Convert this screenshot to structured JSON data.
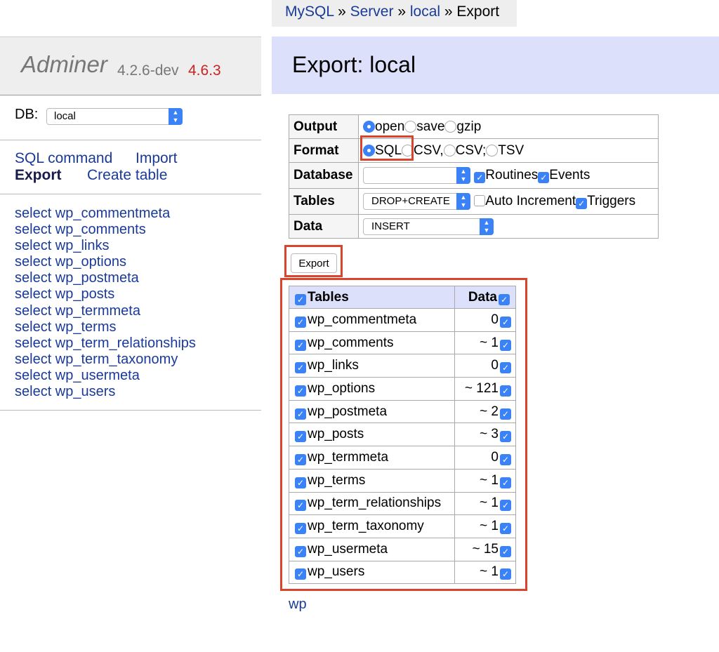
{
  "breadcrumb": {
    "mysql": "MySQL",
    "server": "Server",
    "local": "local",
    "current": "Export",
    "sep": "»"
  },
  "logo": {
    "name": "Adminer",
    "version": "4.2.6-dev",
    "new_version": "4.6.3"
  },
  "db": {
    "label": "DB:",
    "selected": "local"
  },
  "menu": {
    "sql_command": "SQL command",
    "import": "Import",
    "export": "Export",
    "create_table": "Create table"
  },
  "table_links": [
    "select wp_commentmeta",
    "select wp_comments",
    "select wp_links",
    "select wp_options",
    "select wp_postmeta",
    "select wp_posts",
    "select wp_termmeta",
    "select wp_terms",
    "select wp_term_relationships",
    "select wp_term_taxonomy",
    "select wp_usermeta",
    "select wp_users"
  ],
  "title": "Export: local",
  "options": {
    "output": {
      "label": "Output",
      "choices": [
        "open",
        "save",
        "gzip"
      ],
      "selected": "open"
    },
    "format": {
      "label": "Format",
      "choices": [
        "SQL",
        "CSV,",
        "CSV;",
        "TSV"
      ],
      "selected": "SQL"
    },
    "database": {
      "label": "Database",
      "value": "",
      "routines": "Routines",
      "events": "Events"
    },
    "tables": {
      "label": "Tables",
      "value": "DROP+CREATE",
      "auto_increment": "Auto Increment",
      "triggers": "Triggers"
    },
    "data": {
      "label": "Data",
      "value": "INSERT"
    }
  },
  "export_button": "Export",
  "grid": {
    "header_tables": "Tables",
    "header_data": "Data",
    "rows": [
      {
        "name": "wp_commentmeta",
        "count": "0"
      },
      {
        "name": "wp_comments",
        "count": "~ 1"
      },
      {
        "name": "wp_links",
        "count": "0"
      },
      {
        "name": "wp_options",
        "count": "~ 121"
      },
      {
        "name": "wp_postmeta",
        "count": "~ 2"
      },
      {
        "name": "wp_posts",
        "count": "~ 3"
      },
      {
        "name": "wp_termmeta",
        "count": "0"
      },
      {
        "name": "wp_terms",
        "count": "~ 1"
      },
      {
        "name": "wp_term_relationships",
        "count": "~ 1"
      },
      {
        "name": "wp_term_taxonomy",
        "count": "~ 1"
      },
      {
        "name": "wp_usermeta",
        "count": "~ 15"
      },
      {
        "name": "wp_users",
        "count": "~ 1"
      }
    ]
  },
  "footer_link": "wp",
  "colors": {
    "link": "#1a3a9a",
    "highlight": "#d9442b",
    "accent": "#3b82f6",
    "header_bg": "#dde0fa"
  }
}
